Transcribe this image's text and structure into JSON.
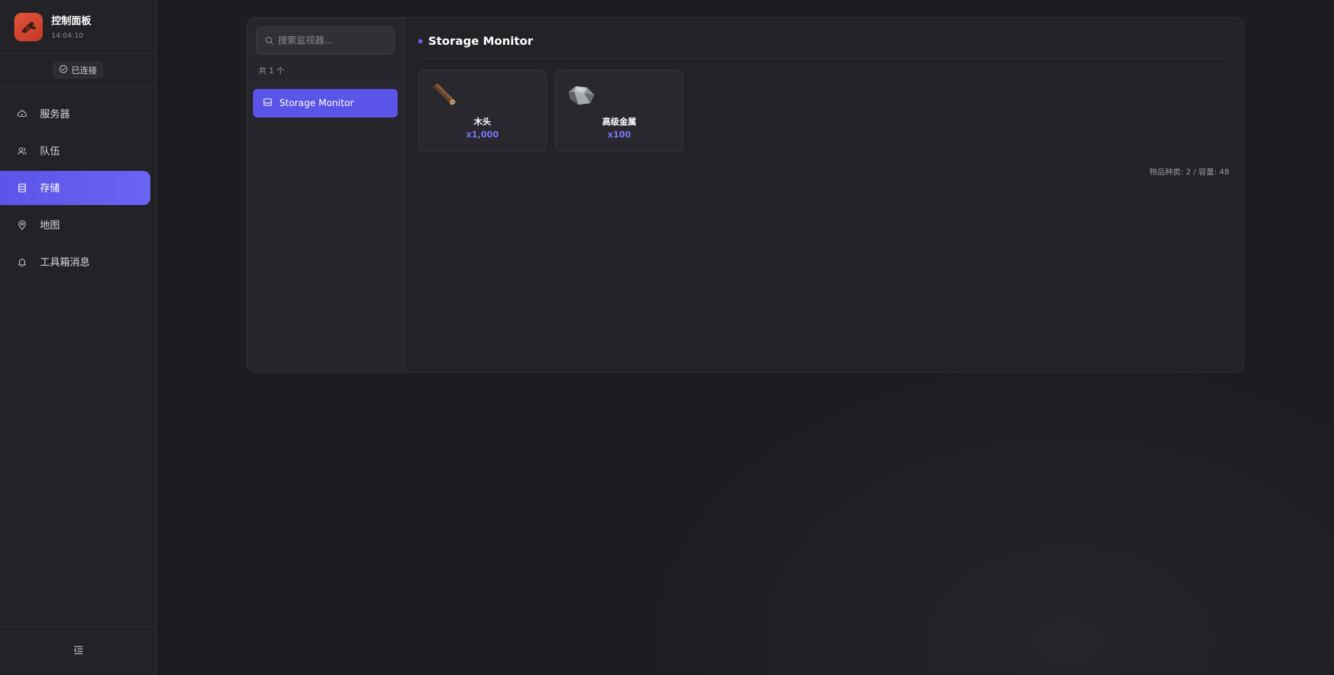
{
  "app": {
    "title": "控制面板",
    "time": "14:04:10",
    "brand_color": "#d9472f",
    "logo_icon": "wrench-icon"
  },
  "connection": {
    "status_label": "已连接",
    "icon": "check-circle-icon"
  },
  "sidebar": {
    "items": [
      {
        "label": "服务器",
        "icon": "cloud-icon",
        "active": false
      },
      {
        "label": "队伍",
        "icon": "team-icon",
        "active": false
      },
      {
        "label": "存储",
        "icon": "storage-icon",
        "active": true
      },
      {
        "label": "地图",
        "icon": "map-pin-icon",
        "active": false
      },
      {
        "label": "工具箱消息",
        "icon": "bell-icon",
        "active": false
      }
    ],
    "collapse_icon": "collapse-menu-icon",
    "accent_color": "#5b54e8"
  },
  "monitors": {
    "search_placeholder": "搜索监视器...",
    "count_label": "共 1 个",
    "items": [
      {
        "name": "Storage Monitor",
        "icon": "inbox-icon",
        "selected": true
      }
    ]
  },
  "storage": {
    "title": "Storage Monitor",
    "items": [
      {
        "name": "木头",
        "quantity": "x1,000",
        "icon": "wood-log-icon"
      },
      {
        "name": "高级金属",
        "quantity": "x100",
        "icon": "hq-metal-icon"
      }
    ],
    "summary": "物品种类: 2 / 容量: 48",
    "quantity_color": "#7c74f4"
  }
}
